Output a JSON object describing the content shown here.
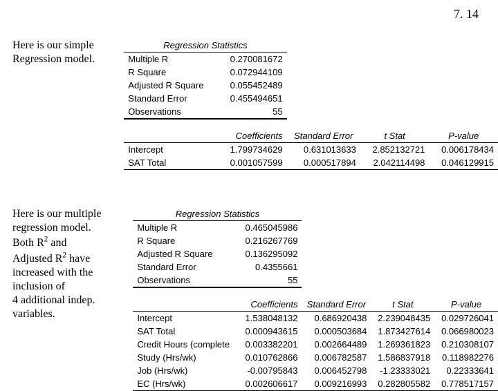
{
  "page_number": "7. 14",
  "caption1": {
    "line1": "Here is our simple",
    "line2": "Regression model."
  },
  "caption2": {
    "line1": "Here is our multiple",
    "line2": "regression model.",
    "line3a": "Both R",
    "line3b": " and",
    "line4a": "Adjusted R",
    "line4b": " have",
    "line5": "increased with the",
    "line6": "inclusion of",
    "line7": "4 additional indep.",
    "line8": "variables.",
    "sup": "2"
  },
  "table1": {
    "stats_title": "Regression Statistics",
    "stats": [
      {
        "label": "Multiple R",
        "value": "0.270081672"
      },
      {
        "label": "R Square",
        "value": "0.072944109"
      },
      {
        "label": "Adjusted R Square",
        "value": "0.055452489"
      },
      {
        "label": "Standard Error",
        "value": "0.455494651"
      },
      {
        "label": "Observations",
        "value": "55"
      }
    ],
    "coef_headers": [
      "",
      "Coefficients",
      "Standard Error",
      "t Stat",
      "P-value"
    ],
    "coef_rows": [
      {
        "label": "Intercept",
        "coef": "1.799734629",
        "se": "0.631013633",
        "t": "2.852132721",
        "p": "0.006178434"
      },
      {
        "label": "SAT Total",
        "coef": "0.001057599",
        "se": "0.000517894",
        "t": "2.042114498",
        "p": "0.046129915"
      }
    ]
  },
  "table2": {
    "stats_title": "Regression Statistics",
    "stats": [
      {
        "label": "Multiple R",
        "value": "0.465045986"
      },
      {
        "label": "R Square",
        "value": "0.216267769"
      },
      {
        "label": "Adjusted R Square",
        "value": "0.136295092"
      },
      {
        "label": "Standard Error",
        "value": "0.4355661"
      },
      {
        "label": "Observations",
        "value": "55"
      }
    ],
    "coef_headers": [
      "",
      "Coefficients",
      "Standard Error",
      "t Stat",
      "P-value"
    ],
    "coef_rows": [
      {
        "label": "Intercept",
        "coef": "1.538048132",
        "se": "0.686920438",
        "t": "2.239048435",
        "p": "0.029726041"
      },
      {
        "label": "SAT Total",
        "coef": "0.000943615",
        "se": "0.000503684",
        "t": "1.873427614",
        "p": "0.066980023"
      },
      {
        "label": "Credit Hours (complete",
        "coef": "0.003382201",
        "se": "0.002664489",
        "t": "1.269361823",
        "p": "0.210308107"
      },
      {
        "label": "Study (Hrs/wk)",
        "coef": "0.010762866",
        "se": "0.006782587",
        "t": "1.586837918",
        "p": "0.118982276"
      },
      {
        "label": "Job (Hrs/wk)",
        "coef": "-0.00795843",
        "se": "0.006452798",
        "t": "-1.23333021",
        "p": "0.22333641"
      },
      {
        "label": "EC  (Hrs/wk)",
        "coef": "0.002606617",
        "se": "0.009216993",
        "t": "0.282805582",
        "p": "0.778517157"
      }
    ]
  }
}
